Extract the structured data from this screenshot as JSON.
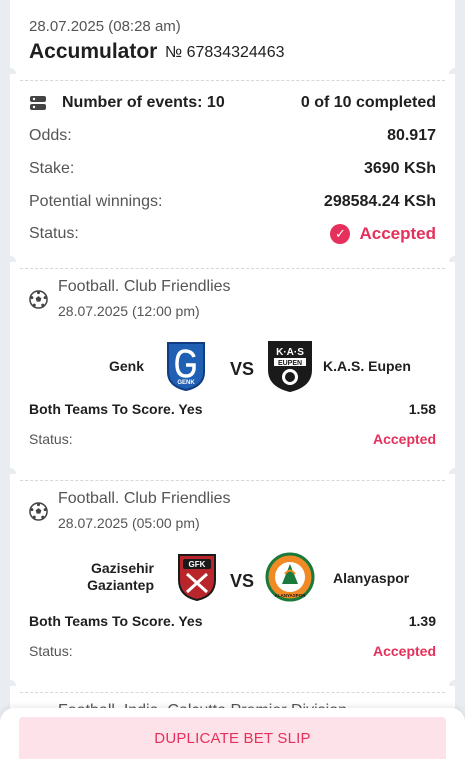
{
  "header": {
    "datetime": "28.07.2025 (08:28 am)",
    "bet_type": "Accumulator",
    "bet_number": "№ 67834324463"
  },
  "summary": {
    "events_label": "Number of events: 10",
    "completed": "0 of 10 completed",
    "odds_label": "Odds:",
    "odds_value": "80.917",
    "stake_label": "Stake:",
    "stake_value": "3690 KSh",
    "winnings_label": "Potential winnings:",
    "winnings_value": "298584.24 KSh",
    "status_label": "Status:",
    "status_value": "Accepted"
  },
  "events": [
    {
      "league": "Football. Club Friendlies",
      "date": "28.07.2025 (12:00 pm)",
      "home": "Genk",
      "away": "K.A.S. Eupen",
      "vs": "VS",
      "market": "Both Teams To Score. Yes",
      "odds": "1.58",
      "status_label": "Status:",
      "status": "Accepted",
      "home_logo_text": "GENK",
      "away_logo_text": "K·A·S",
      "away_logo_sub": "EUPEN"
    },
    {
      "league": "Football. Club Friendlies",
      "date": "28.07.2025 (05:00 pm)",
      "home": "Gazisehir Gaziantep",
      "away": "Alanyaspor",
      "vs": "VS",
      "market": "Both Teams To Score. Yes",
      "odds": "1.39",
      "status_label": "Status:",
      "status": "Accepted",
      "home_logo_text": "GFK",
      "away_logo_text": "ALANYASPOR"
    },
    {
      "league": "Football. India. Calcutta Premier Division"
    }
  ],
  "footer": {
    "duplicate_label": "DUPLICATE BET SLIP"
  },
  "colors": {
    "accent": "#e5305b",
    "background": "#e9ecf1",
    "button_bg": "#fde3e9"
  }
}
